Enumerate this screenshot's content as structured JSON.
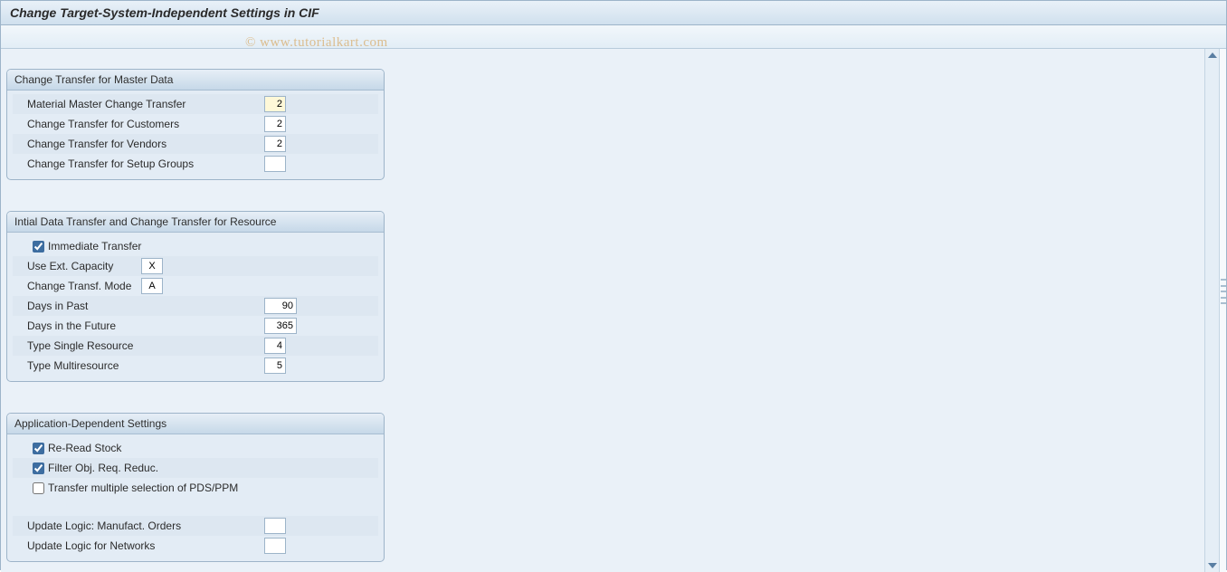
{
  "title": "Change Target-System-Independent Settings in CIF",
  "watermark": "© www.tutorialkart.com",
  "group1": {
    "title": "Change Transfer for Master Data",
    "rows": {
      "r0": {
        "label": "Material Master Change Transfer",
        "value": "2"
      },
      "r1": {
        "label": "Change Transfer for Customers",
        "value": "2"
      },
      "r2": {
        "label": "Change Transfer for Vendors",
        "value": "2"
      },
      "r3": {
        "label": "Change Transfer for Setup Groups",
        "value": ""
      }
    }
  },
  "group2": {
    "title": "Intial Data Transfer and Change Transfer for Resource",
    "immediate_label": "Immediate Transfer",
    "rows": {
      "ext_cap": {
        "label": "Use Ext. Capacity",
        "value": "X"
      },
      "mode": {
        "label": "Change Transf. Mode",
        "value": "A"
      },
      "past": {
        "label": "Days in Past",
        "value": "90"
      },
      "future": {
        "label": "Days in the Future",
        "value": "365"
      },
      "single": {
        "label": "Type Single Resource",
        "value": "4"
      },
      "multi": {
        "label": "Type Multiresource",
        "value": "5"
      }
    }
  },
  "group3": {
    "title": "Application-Dependent Settings",
    "checks": {
      "reread": "Re-Read Stock",
      "filter": "Filter Obj. Req. Reduc.",
      "pdsppm": "Transfer multiple selection of PDS/PPM"
    },
    "rows": {
      "manuf": {
        "label": "Update Logic: Manufact. Orders",
        "value": ""
      },
      "netw": {
        "label": "Update Logic for Networks",
        "value": ""
      }
    }
  }
}
